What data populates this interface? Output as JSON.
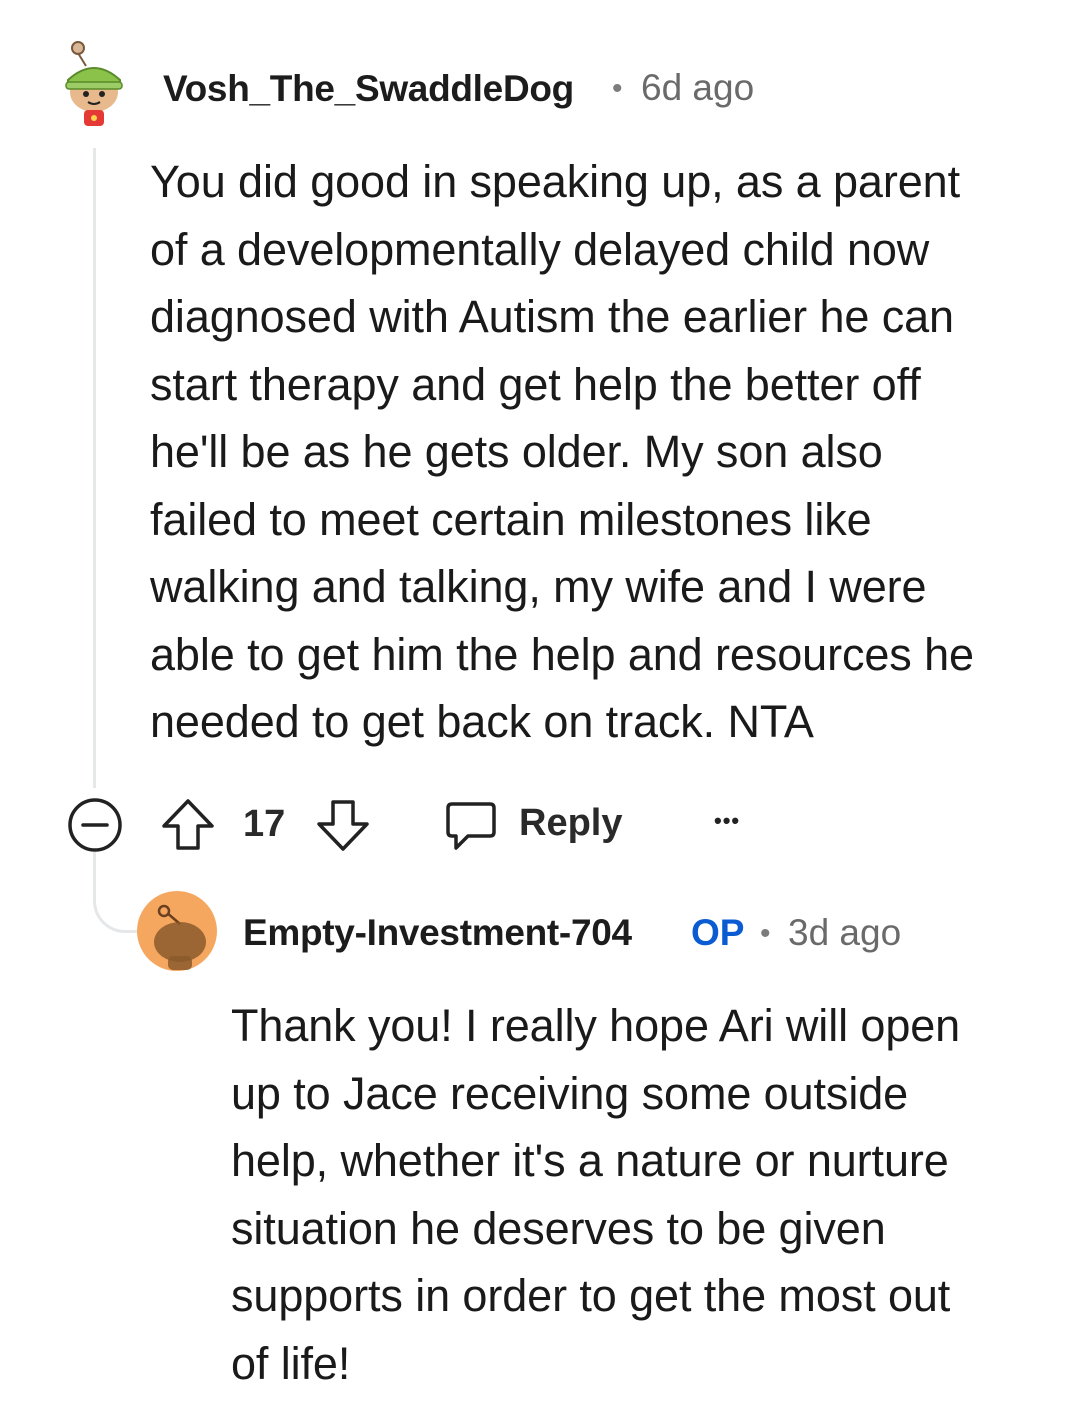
{
  "comment": {
    "username": "Vosh_The_SwaddleDog",
    "separator": "•",
    "timestamp": "6d ago",
    "body_lines": [
      "You did good in speaking up, as a parent",
      "of a developmentally delayed child now",
      "diagnosed with Autism the earlier he can",
      "start therapy and get help the better off",
      "he'll be as he gets older. My son also",
      "failed to meet certain milestones like",
      "walking and talking, my wife and I were",
      "able to get him the help and resources he",
      "needed to get back on track. NTA"
    ],
    "score": "17",
    "reply_label": "Reply",
    "more_label": "•••"
  },
  "reply": {
    "username": "Empty-Investment-704",
    "badge": "OP",
    "separator": "•",
    "timestamp": "3d ago",
    "body_lines": [
      "Thank you! I really hope Ari will open",
      "up to Jace receiving some outside",
      "help, whether it's a nature or nurture",
      "situation he deserves to be given",
      "supports in order to get the most out",
      "of life!"
    ]
  },
  "icons": {
    "avatar_1": "snoo-green-hat-avatar-icon",
    "avatar_2": "snoo-orange-avatar-icon",
    "collapse": "collapse-minus-icon",
    "upvote": "upvote-arrow-icon",
    "downvote": "downvote-arrow-icon",
    "reply": "speech-bubble-icon"
  },
  "colors": {
    "op_badge": "#0b5bd3",
    "thread_line": "#e5e7e9",
    "avatar2_bg": "#f6a75f"
  }
}
